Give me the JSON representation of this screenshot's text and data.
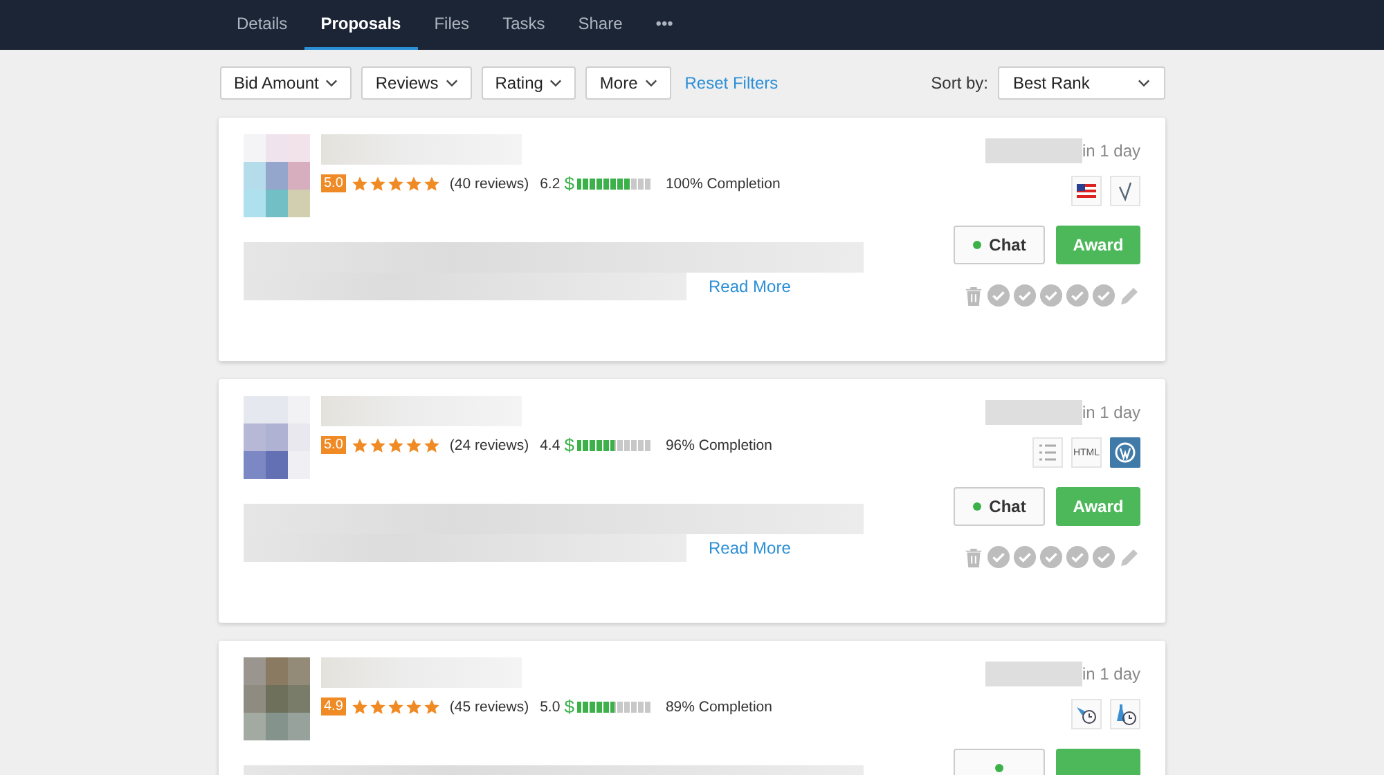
{
  "tabs": [
    {
      "label": "Details",
      "selected": false
    },
    {
      "label": "Proposals",
      "selected": true
    },
    {
      "label": "Files",
      "selected": false
    },
    {
      "label": "Tasks",
      "selected": false
    },
    {
      "label": "Share",
      "selected": false
    },
    {
      "label": "•••",
      "selected": false
    }
  ],
  "filters": [
    {
      "label": "Bid Amount"
    },
    {
      "label": "Reviews"
    },
    {
      "label": "Rating"
    },
    {
      "label": "More"
    }
  ],
  "reset_filters": "Reset Filters",
  "sort": {
    "label": "Sort by:",
    "value": "Best Rank"
  },
  "proposals": [
    {
      "rating": "5.0",
      "stars": 5,
      "reviews": "(40 reviews)",
      "earnings": "6.2",
      "currency": "$",
      "level": 0.7,
      "completion": "100% Completion",
      "read_more": "Read More",
      "delivery": "in 1 day",
      "badges": [
        {
          "kind": "flag"
        },
        {
          "kind": "check"
        }
      ],
      "chat": "Chat",
      "award": "Award"
    },
    {
      "rating": "5.0",
      "stars": 5,
      "reviews": "(24 reviews)",
      "earnings": "4.4",
      "currency": "$",
      "level": 0.5,
      "completion": "96% Completion",
      "read_more": "Read More",
      "delivery": "in 1 day",
      "badges": [
        {
          "kind": "list"
        },
        {
          "kind": "html",
          "label": "HTML"
        },
        {
          "kind": "wordpress"
        }
      ],
      "chat": "Chat",
      "award": "Award"
    },
    {
      "rating": "4.9",
      "stars": 5,
      "reviews": "(45 reviews)",
      "earnings": "5.0",
      "currency": "$",
      "level": 0.5,
      "completion": "89% Completion",
      "delivery": "in 1 day",
      "badges": [
        {
          "kind": "clock-a"
        },
        {
          "kind": "clock-b"
        }
      ]
    }
  ]
}
